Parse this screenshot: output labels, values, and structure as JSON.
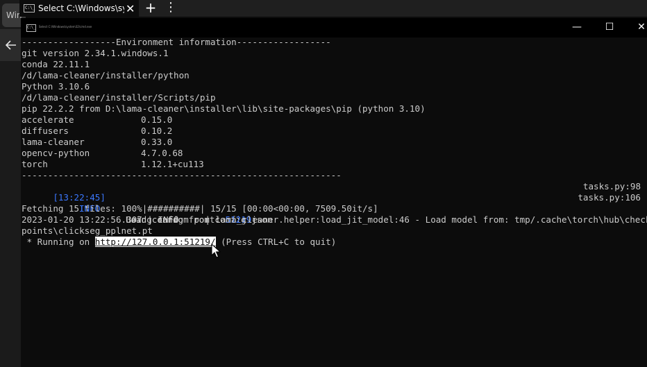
{
  "background_window": {
    "tab_label": "Win"
  },
  "tab": {
    "title": "Select C:\\Windows\\sy..."
  },
  "tabbar": {
    "close_glyph": "✕",
    "new_tab_glyph": "+",
    "dropdown_glyph": "⋮"
  },
  "cmd_window": {
    "icon_text": "C:\\_",
    "title": "Select C:\\Windows\\system32\\cmd.exe",
    "minimize_glyph": "—",
    "maximize_glyph": "☐",
    "close_glyph": "✕"
  },
  "terminal": {
    "env_header": "------------------Environment information------------------",
    "env_lines": [
      "git version 2.34.1.windows.1",
      "conda 22.11.1",
      "/d/lama-cleaner/installer/python",
      "Python 3.10.6",
      "/d/lama-cleaner/installer/Scripts/pip",
      "pip 22.2.2 from D:\\lama-cleaner\\installer\\lib\\site-packages\\pip (python 3.10)"
    ],
    "packages": [
      {
        "name": "accelerate",
        "version": "0.15.0"
      },
      {
        "name": "diffusers",
        "version": "0.10.2"
      },
      {
        "name": "lama-cleaner",
        "version": "0.33.0"
      },
      {
        "name": "opencv-python",
        "version": "4.7.0.68"
      },
      {
        "name": "torch",
        "version": "1.12.1+cu113"
      }
    ],
    "env_footer": "-------------------------------------------------------------",
    "log1": {
      "timestamp": "[13:22:45]",
      "level": "INFO",
      "message": "Load config from config.json",
      "source": "tasks.py:98"
    },
    "log2": {
      "level": "INFO",
      "message": "Using random port: ",
      "port": "51219",
      "source": "tasks.py:106"
    },
    "fetching": "Fetching 15 files: 100%|##########| 15/15 [00:00<00:00, 7509.50it/s]",
    "load_line": "2023-01-20 13:22:56.307 | INFO     | lama_cleaner.helper:load_jit_model:46 - Load model from: tmp/.cache\\torch\\hub\\check",
    "load_line_cont": "points\\clickseg_pplnet.pt",
    "running_prefix": " * Running on ",
    "running_url": "http://127.0.0.1:51219/",
    "running_suffix": " (Press CTRL+C to quit)"
  },
  "colors": {
    "background": "#0c0c0c",
    "text": "#cccccc",
    "accent_blue": "#3b78ff",
    "selection": "#ffffff"
  },
  "icons": [
    "arrow-left-icon",
    "cmd-icon",
    "close-icon",
    "plus-icon",
    "more-vertical-icon",
    "minimize-icon",
    "maximize-icon",
    "mouse-cursor-icon"
  ]
}
